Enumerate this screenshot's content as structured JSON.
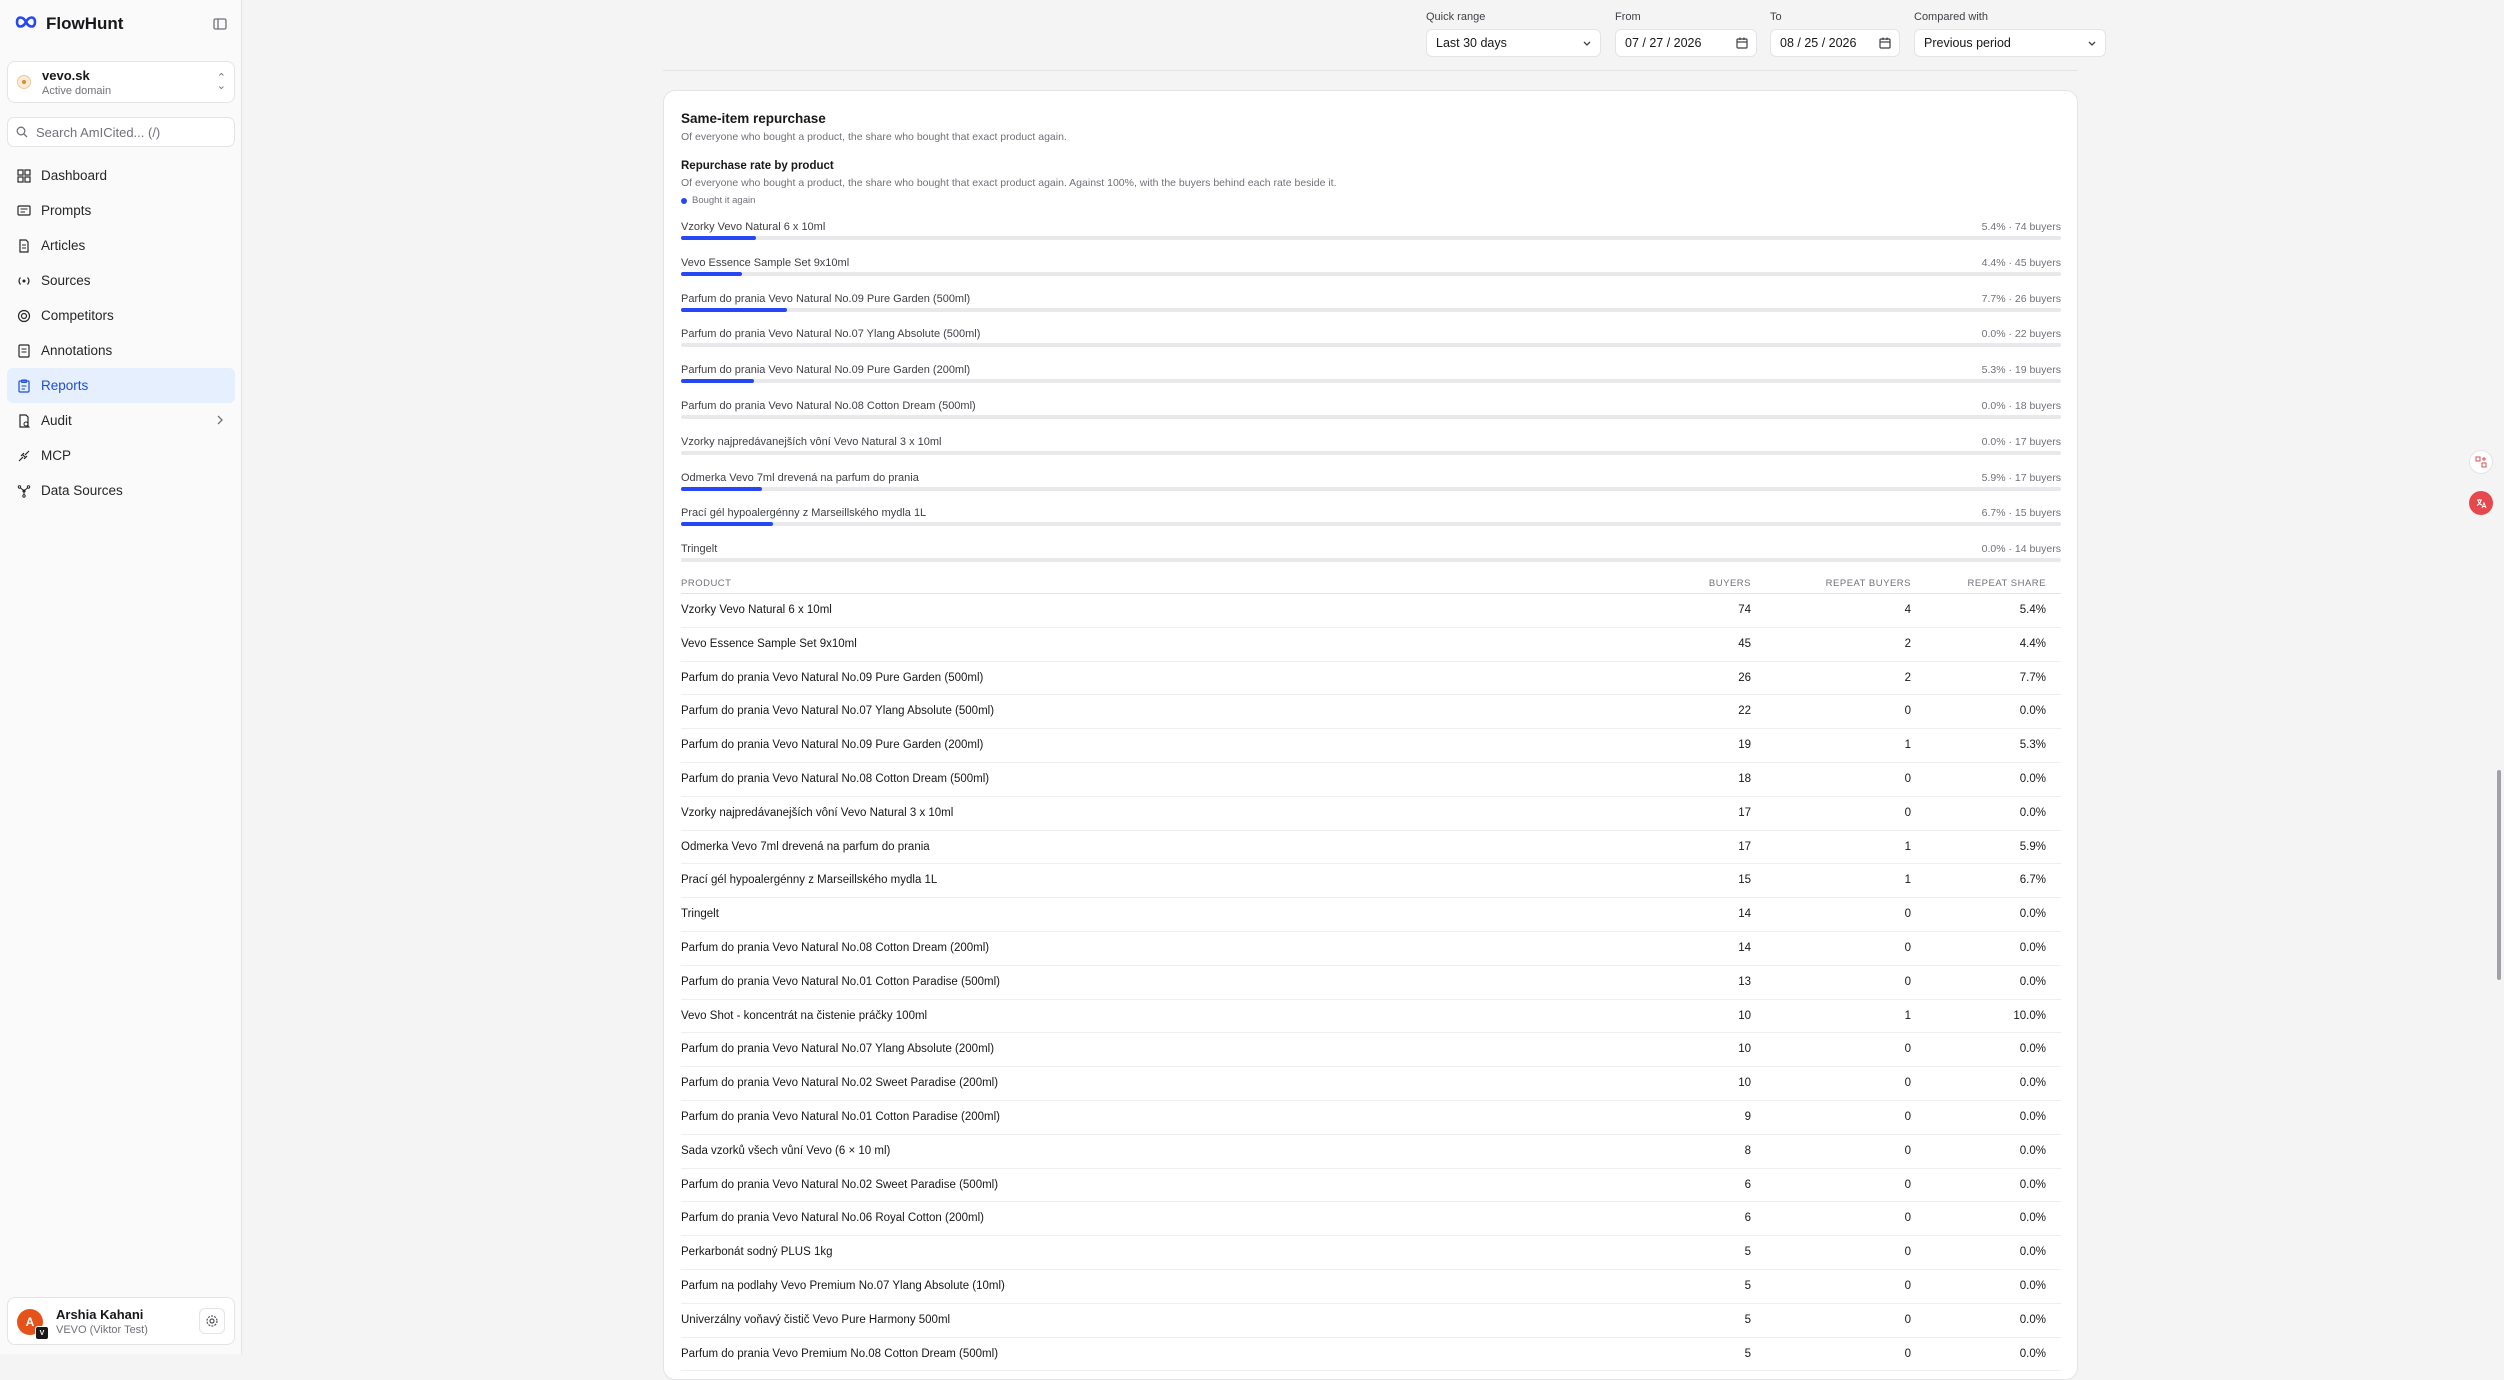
{
  "app": {
    "name": "FlowHunt"
  },
  "domain": {
    "name": "vevo.sk",
    "subtitle": "Active domain"
  },
  "search": {
    "placeholder": "Search AmICited... (/)"
  },
  "nav": [
    {
      "label": "Dashboard",
      "icon": "dashboard-icon",
      "active": false
    },
    {
      "label": "Prompts",
      "icon": "prompts-icon",
      "active": false
    },
    {
      "label": "Articles",
      "icon": "articles-icon",
      "active": false
    },
    {
      "label": "Sources",
      "icon": "sources-icon",
      "active": false
    },
    {
      "label": "Competitors",
      "icon": "competitors-icon",
      "active": false
    },
    {
      "label": "Annotations",
      "icon": "annotations-icon",
      "active": false
    },
    {
      "label": "Reports",
      "icon": "reports-icon",
      "active": true
    },
    {
      "label": "Audit",
      "icon": "audit-icon",
      "active": false,
      "has_chevron": true
    },
    {
      "label": "MCP",
      "icon": "mcp-icon",
      "active": false
    },
    {
      "label": "Data Sources",
      "icon": "data-sources-icon",
      "active": false
    }
  ],
  "user": {
    "name": "Arshia Kahani",
    "org": "VEVO (Viktor Test)",
    "initial": "A",
    "badge": "V"
  },
  "filters": {
    "quick_range_label": "Quick range",
    "quick_range_value": "Last 30 days",
    "from_label": "From",
    "from_value": "07 / 27 / 2026",
    "to_label": "To",
    "to_value": "08 / 25 / 2026",
    "compared_label": "Compared with",
    "compared_value": "Previous period"
  },
  "section": {
    "title": "Same-item repurchase",
    "subtitle": "Of everyone who bought a product, the share who bought that exact product again."
  },
  "chart_title": "Repurchase rate by product",
  "chart_subtitle": "Of everyone who bought a product, the share who bought that exact product again. Against 100%, with the buyers behind each rate beside it.",
  "legend_label": "Bought it again",
  "colors": {
    "accent": "#2547f4",
    "active_nav": "#1d4ed8"
  },
  "chart_data": {
    "type": "bar",
    "orientation": "horizontal",
    "title": "Repurchase rate by product",
    "series": [
      {
        "name": "Bought it again",
        "color": "#2547f4"
      }
    ],
    "xlim": [
      0,
      100
    ],
    "categories": [
      "Vzorky Vevo Natural 6 x 10ml",
      "Vevo Essence Sample Set 9x10ml",
      "Parfum do prania Vevo Natural No.09 Pure Garden (500ml)",
      "Parfum do prania Vevo Natural No.07 Ylang Absolute (500ml)",
      "Parfum do prania Vevo Natural No.09 Pure Garden (200ml)",
      "Parfum do prania Vevo Natural No.08 Cotton Dream (500ml)",
      "Vzorky najpredávanejších vôní Vevo Natural 3 x 10ml",
      "Odmerka Vevo 7ml drevená na parfum do prania",
      "Prací gél hypoalergénny z Marseillského mydla 1L",
      "Tringelt"
    ],
    "values": [
      5.4,
      4.4,
      7.7,
      0.0,
      5.3,
      0.0,
      0.0,
      5.9,
      6.7,
      0.0
    ],
    "labels": [
      "5.4% · 74 buyers",
      "4.4% · 45 buyers",
      "7.7% · 26 buyers",
      "0.0% · 22 buyers",
      "5.3% · 19 buyers",
      "0.0% · 18 buyers",
      "0.0% · 17 buyers",
      "5.9% · 17 buyers",
      "6.7% · 15 buyers",
      "0.0% · 14 buyers"
    ]
  },
  "table": {
    "headers": [
      "PRODUCT",
      "BUYERS",
      "REPEAT BUYERS",
      "REPEAT SHARE"
    ],
    "rows": [
      [
        "Vzorky Vevo Natural 6 x 10ml",
        "74",
        "4",
        "5.4%"
      ],
      [
        "Vevo Essence Sample Set 9x10ml",
        "45",
        "2",
        "4.4%"
      ],
      [
        "Parfum do prania Vevo Natural No.09 Pure Garden (500ml)",
        "26",
        "2",
        "7.7%"
      ],
      [
        "Parfum do prania Vevo Natural No.07 Ylang Absolute (500ml)",
        "22",
        "0",
        "0.0%"
      ],
      [
        "Parfum do prania Vevo Natural No.09 Pure Garden (200ml)",
        "19",
        "1",
        "5.3%"
      ],
      [
        "Parfum do prania Vevo Natural No.08 Cotton Dream (500ml)",
        "18",
        "0",
        "0.0%"
      ],
      [
        "Vzorky najpredávanejších vôní Vevo Natural 3 x 10ml",
        "17",
        "0",
        "0.0%"
      ],
      [
        "Odmerka Vevo 7ml drevená na parfum do prania",
        "17",
        "1",
        "5.9%"
      ],
      [
        "Prací gél hypoalergénny z Marseillského mydla 1L",
        "15",
        "1",
        "6.7%"
      ],
      [
        "Tringelt",
        "14",
        "0",
        "0.0%"
      ],
      [
        "Parfum do prania Vevo Natural No.08 Cotton Dream (200ml)",
        "14",
        "0",
        "0.0%"
      ],
      [
        "Parfum do prania Vevo Natural No.01 Cotton Paradise (500ml)",
        "13",
        "0",
        "0.0%"
      ],
      [
        "Vevo Shot - koncentrát na čistenie práčky 100ml",
        "10",
        "1",
        "10.0%"
      ],
      [
        "Parfum do prania Vevo Natural No.07 Ylang Absolute (200ml)",
        "10",
        "0",
        "0.0%"
      ],
      [
        "Parfum do prania Vevo Natural No.02 Sweet Paradise (200ml)",
        "10",
        "0",
        "0.0%"
      ],
      [
        "Parfum do prania Vevo Natural No.01 Cotton Paradise (200ml)",
        "9",
        "0",
        "0.0%"
      ],
      [
        "Sada vzorků všech vůní Vevo (6 × 10 ml)",
        "8",
        "0",
        "0.0%"
      ],
      [
        "Parfum do prania Vevo Natural No.02 Sweet Paradise (500ml)",
        "6",
        "0",
        "0.0%"
      ],
      [
        "Parfum do prania Vevo Natural No.06 Royal Cotton (200ml)",
        "6",
        "0",
        "0.0%"
      ],
      [
        "Perkarbonát sodný PLUS 1kg",
        "5",
        "0",
        "0.0%"
      ],
      [
        "Parfum na podlahy Vevo Premium No.07 Ylang Absolute (10ml)",
        "5",
        "0",
        "0.0%"
      ],
      [
        "Univerzálny voňavý čistič Vevo Pure Harmony 500ml",
        "5",
        "0",
        "0.0%"
      ],
      [
        "Parfum do prania Vevo Premium No.08 Cotton Dream (500ml)",
        "5",
        "0",
        "0.0%"
      ]
    ]
  }
}
